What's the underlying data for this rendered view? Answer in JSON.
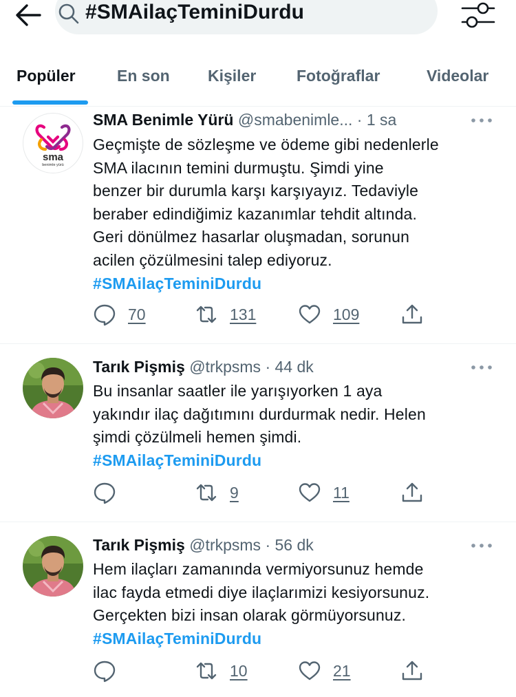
{
  "search": {
    "query": "#SMAilaçTeminiDurdu"
  },
  "icons": {
    "back": "arrow-left-icon",
    "search": "search-icon",
    "filter": "sliders-icon"
  },
  "tabs": [
    {
      "label": "Popüler",
      "active": true
    },
    {
      "label": "En son",
      "active": false
    },
    {
      "label": "Kişiler",
      "active": false
    },
    {
      "label": "Fotoğraflar",
      "active": false
    },
    {
      "label": "Videolar",
      "active": false
    }
  ],
  "colors": {
    "accent": "#1d9bf0",
    "text": "#0f1419",
    "secondary": "#536471",
    "logo_pink": "#e6007e"
  },
  "tweets": [
    {
      "name": "SMA Benimle Yürü",
      "handle": "@smabenimle...",
      "time": "1 sa",
      "avatar_logo": {
        "title": "sma",
        "subtitle": "benimle yürü"
      },
      "lines": [
        "Geçmişte de sözleşme ve ödeme gibi nedenlerle",
        "SMA ilacının temini durmuştu. Şimdi yine",
        "benzer bir durumla karşı karşıyayız. Tedaviyle",
        "beraber edindiğimiz kazanımlar tehdit altında.",
        "Geri dönülmez hasarlar oluşmadan, sorunun",
        "acilen çözülmesini talep ediyoruz."
      ],
      "hashtag": "#SMAilaçTeminiDurdu",
      "replies": "70",
      "retweets": "131",
      "likes": "109"
    },
    {
      "name": "Tarık Pişmiş",
      "handle": "@trkpsms",
      "time": "44 dk",
      "lines": [
        "Bu insanlar saatler ile yarışıyorken 1 aya",
        "yakındır ilaç dağıtımını durdurmak nedir. Helen",
        "şimdi çözülmeli hemen şimdi."
      ],
      "hashtag": "#SMAilaçTeminiDurdu",
      "replies": "",
      "retweets": "9",
      "likes": "11"
    },
    {
      "name": "Tarık Pişmiş",
      "handle": "@trkpsms",
      "time": "56 dk",
      "lines": [
        "Hem ilaçları zamanında vermiyorsunuz hemde",
        "ilac fayda etmedi diye ilaçlarımizi kesiyorsunuz.",
        "Gerçekten bizi insan olarak görmüyorsunuz."
      ],
      "hashtag": "#SMAilaçTeminiDurdu",
      "replies": "",
      "retweets": "10",
      "likes": "21"
    }
  ]
}
